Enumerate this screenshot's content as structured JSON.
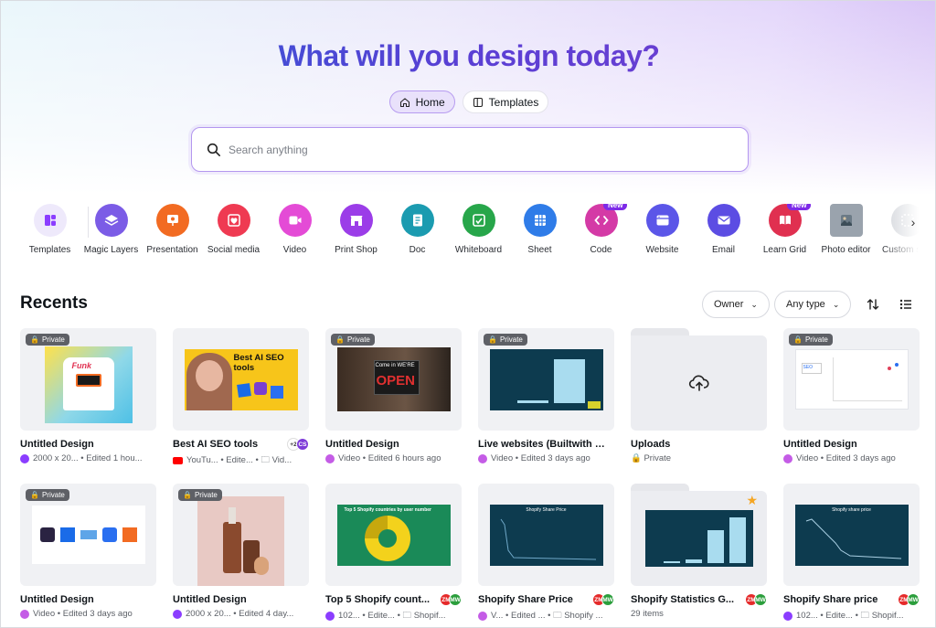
{
  "hero": {
    "title": "What will you design today?"
  },
  "tabs": [
    {
      "label": "Home",
      "icon": "home-icon",
      "active": true
    },
    {
      "label": "Templates",
      "icon": "templates-icon",
      "active": false
    }
  ],
  "search": {
    "placeholder": "Search anything"
  },
  "design_types": [
    {
      "label": "Templates",
      "color": "#eee9fb",
      "icon": "templates-grid-icon"
    },
    {
      "label": "Magic Layers",
      "color": "#7b5ce6",
      "icon": "magic-layers-icon"
    },
    {
      "label": "Presentation",
      "color": "#f26b22",
      "icon": "presentation-icon"
    },
    {
      "label": "Social media",
      "color": "#ef3a52",
      "icon": "heart-icon"
    },
    {
      "label": "Video",
      "color": "#e44bd6",
      "icon": "video-icon"
    },
    {
      "label": "Print Shop",
      "color": "#9b3de8",
      "icon": "store-icon"
    },
    {
      "label": "Doc",
      "color": "#1b9bb0",
      "icon": "doc-icon"
    },
    {
      "label": "Whiteboard",
      "color": "#27a64a",
      "icon": "whiteboard-icon"
    },
    {
      "label": "Sheet",
      "color": "#2f7ce8",
      "icon": "sheet-icon"
    },
    {
      "label": "Code",
      "color": "#d43aa6",
      "icon": "code-icon",
      "badge": "New"
    },
    {
      "label": "Website",
      "color": "#5b56e8",
      "icon": "website-icon"
    },
    {
      "label": "Email",
      "color": "#5c4de3",
      "icon": "email-icon"
    },
    {
      "label": "Learn Grid",
      "color": "#e03050",
      "icon": "book-icon",
      "badge": "New"
    },
    {
      "label": "Photo editor",
      "color": "#9aa3ad",
      "icon": "photo-icon"
    },
    {
      "label": "Custom size",
      "color": "#cfd2d8",
      "icon": "custom-size-icon"
    }
  ],
  "recents": {
    "title": "Recents",
    "owner_label": "Owner",
    "type_label": "Any type",
    "items": [
      {
        "title": "Untitled Design",
        "private": "Private",
        "meta_icon": "purple",
        "meta": "2000 x 20... • Edited 1 hou...",
        "thumb": "tshirt",
        "badge_text": "Funk"
      },
      {
        "title": "Best AI SEO tools",
        "private": "",
        "meta_icon": "yt",
        "meta": "YouTu... • Edite... • 🗀 Vid...",
        "thumb": "seo",
        "avatars": [
          "+2",
          "CS"
        ],
        "thumb_title": "Best AI SEO tools"
      },
      {
        "title": "Untitled Design",
        "private": "Private",
        "meta_icon": "video",
        "meta": "Video • Edited 6 hours ago",
        "thumb": "open",
        "sign_top": "Come in WE'RE",
        "sign_main": "OPEN"
      },
      {
        "title": "Live websites (Builtwith e...",
        "private": "Private",
        "meta_icon": "video",
        "meta": "Video • Edited 3 days ago",
        "thumb": "bars-dark"
      },
      {
        "title": "Uploads",
        "private": "",
        "meta_icon": "",
        "meta": "🔒 Private",
        "thumb": "folder-upload"
      },
      {
        "title": "Untitled Design",
        "private": "Private",
        "meta_icon": "video",
        "meta": "Video • Edited 3 days ago",
        "thumb": "dashboard",
        "dash_label": "SEO"
      },
      {
        "title": "Untitled Design",
        "private": "Private",
        "meta_icon": "video",
        "meta": "Video • Edited 3 days ago",
        "thumb": "logos"
      },
      {
        "title": "Untitled Design",
        "private": "Private",
        "meta_icon": "purple",
        "meta": "2000 x 20... • Edited 4 day...",
        "thumb": "bottles"
      },
      {
        "title": "Top 5 Shopify count...",
        "private": "",
        "meta_icon": "purple",
        "meta": "102... • Edite... • 🗀 Shopif...",
        "thumb": "donut",
        "avatars": [
          "ZM",
          "MW"
        ],
        "thumb_title": "Top 5 Shopify countries by user number"
      },
      {
        "title": "Shopify Share Price",
        "private": "",
        "meta_icon": "video",
        "meta": "V... • Edited ... • 🗀 Shopify ...",
        "thumb": "line-dark",
        "avatars": [
          "ZM",
          "MW"
        ],
        "thumb_title": "Shopify Share Price"
      },
      {
        "title": "Shopify Statistics G...",
        "private": "",
        "meta_icon": "",
        "meta": "29 items",
        "thumb": "folder-chart",
        "avatars": [
          "ZM",
          "MW"
        ],
        "starred": true
      },
      {
        "title": "Shopify Share price",
        "private": "",
        "meta_icon": "purple",
        "meta": "102... • Edite... • 🗀 Shopif...",
        "thumb": "line-dark2",
        "avatars": [
          "ZM",
          "MW"
        ],
        "thumb_title": "Shopify share price"
      }
    ]
  },
  "colors": {
    "accent": "#8b3dff",
    "title_gradient_start": "#2a5fd6",
    "title_gradient_end": "#7a3fd0"
  }
}
